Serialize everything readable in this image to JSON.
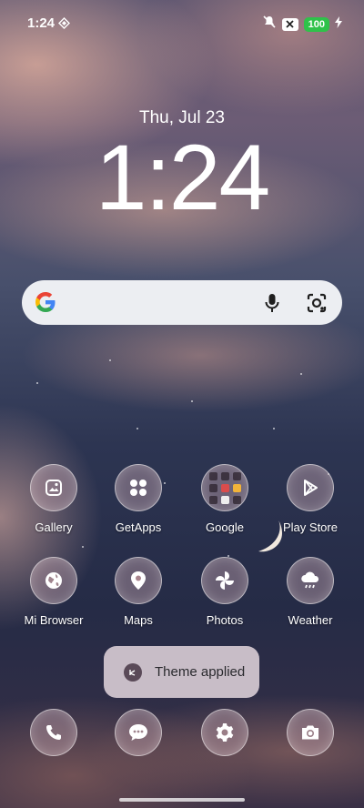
{
  "status_bar": {
    "time": "1:24",
    "battery": "100",
    "icons": [
      "diamond-icon",
      "mute-icon",
      "x-badge-icon",
      "charging-icon"
    ]
  },
  "lockscreen": {
    "date": "Thu, Jul 23",
    "clock": "1:24"
  },
  "search": {
    "icons": [
      "google-logo",
      "mic-icon",
      "lens-icon"
    ]
  },
  "apps": [
    {
      "label": "Gallery",
      "icon": "gallery-icon"
    },
    {
      "label": "GetApps",
      "icon": "getapps-icon"
    },
    {
      "label": "Google",
      "icon": "google-folder-icon"
    },
    {
      "label": "Play Store",
      "icon": "play-store-icon"
    },
    {
      "label": "Mi Browser",
      "icon": "globe-icon"
    },
    {
      "label": "Maps",
      "icon": "maps-icon"
    },
    {
      "label": "Photos",
      "icon": "photos-icon"
    },
    {
      "label": "Weather",
      "icon": "weather-icon"
    }
  ],
  "toast": {
    "text": "Theme applied"
  },
  "dock": [
    {
      "icon": "phone-icon"
    },
    {
      "icon": "messages-icon"
    },
    {
      "icon": "settings-icon"
    },
    {
      "icon": "camera-icon"
    }
  ],
  "colors": {
    "battery": "#2fc24a",
    "search_bg": "#eceef2"
  }
}
